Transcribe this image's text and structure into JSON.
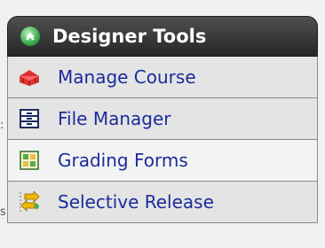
{
  "fragments": [
    ":",
    "s"
  ],
  "panel": {
    "title": "Designer Tools",
    "header_icon": "collapse-chevron-icon",
    "items": [
      {
        "label": "Manage Course",
        "icon": "bricks-icon"
      },
      {
        "label": "File Manager",
        "icon": "file-cabinet-icon"
      },
      {
        "label": "Grading Forms",
        "icon": "grid-form-icon"
      },
      {
        "label": "Selective Release",
        "icon": "release-arrows-icon"
      }
    ]
  },
  "colors": {
    "header_bg": "#333333",
    "link_text": "#1a2c9c",
    "item_bg": "#e4e4e4"
  }
}
